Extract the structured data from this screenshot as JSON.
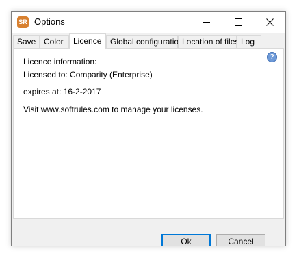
{
  "window": {
    "app_icon_text": "SR",
    "title": "Options"
  },
  "tabs": [
    {
      "label": "Save"
    },
    {
      "label": "Color"
    },
    {
      "label": "Licence",
      "active": true
    },
    {
      "label": "Global configuration"
    },
    {
      "label": "Location of files"
    },
    {
      "label": "Log"
    }
  ],
  "licence": {
    "heading": "Licence information:",
    "licensed_to": "Licensed to: Comparity (Enterprise)",
    "expires": "expires at: 16-2-2017",
    "visit": "Visit www.softrules.com to manage your licenses.",
    "help_glyph": "?"
  },
  "buttons": {
    "ok_label": "Ok",
    "cancel_label": "Cancel"
  },
  "icons": {
    "app": "app-icon",
    "minimize": "minimize-icon",
    "maximize": "maximize-icon",
    "close": "close-icon",
    "help": "help-icon"
  },
  "colors": {
    "app_icon": "#d8802f",
    "help_icon": "#6e9ad8",
    "default_button_border": "#0078d7",
    "dialog_background": "#f0f0f0"
  }
}
